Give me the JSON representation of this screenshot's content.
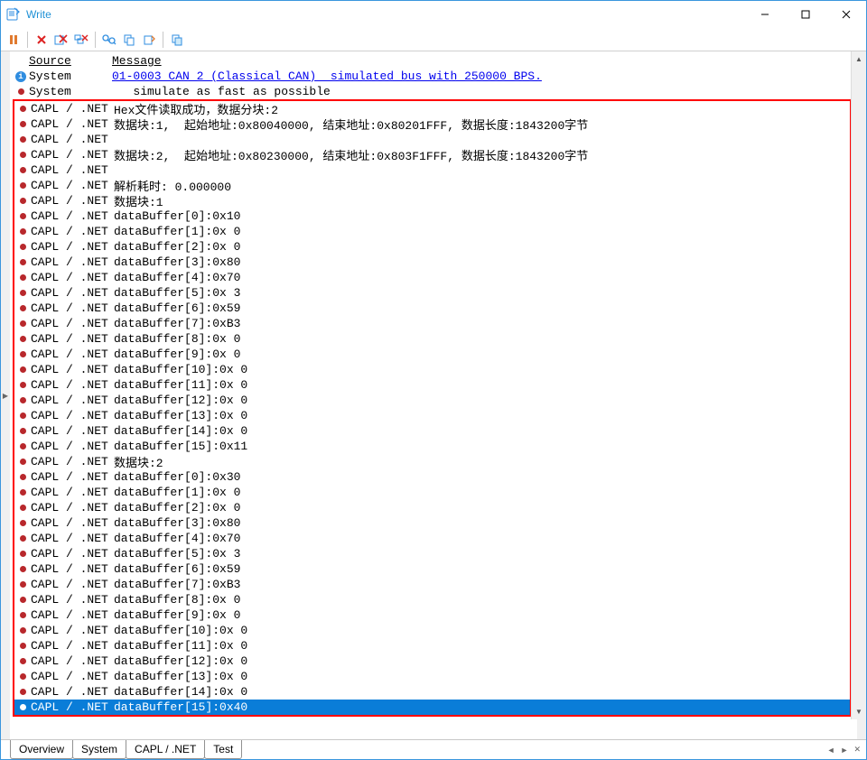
{
  "window": {
    "title": "Write"
  },
  "head": {
    "source": "Source",
    "message": "Message"
  },
  "top_rows": [
    {
      "icon": "info",
      "source": "System",
      "message": "01-0003 CAN 2 (Classical CAN)  simulated bus with 250000 BPS.",
      "link": true
    },
    {
      "icon": "bullet",
      "source": "System",
      "message": "   simulate as fast as possible"
    }
  ],
  "boxed_rows": [
    {
      "source": "CAPL / .NET",
      "message": "Hex文件读取成功，数据分块:2"
    },
    {
      "source": "CAPL / .NET",
      "message": "数据块:1,  起始地址:0x80040000, 结束地址:0x80201FFF, 数据长度:1843200字节"
    },
    {
      "source": "CAPL / .NET",
      "message": ""
    },
    {
      "source": "CAPL / .NET",
      "message": "数据块:2,  起始地址:0x80230000, 结束地址:0x803F1FFF, 数据长度:1843200字节"
    },
    {
      "source": "CAPL / .NET",
      "message": ""
    },
    {
      "source": "CAPL / .NET",
      "message": "解析耗时: 0.000000"
    },
    {
      "source": "CAPL / .NET",
      "message": "数据块:1"
    },
    {
      "source": "CAPL / .NET",
      "message": "dataBuffer[0]:0x10"
    },
    {
      "source": "CAPL / .NET",
      "message": "dataBuffer[1]:0x 0"
    },
    {
      "source": "CAPL / .NET",
      "message": "dataBuffer[2]:0x 0"
    },
    {
      "source": "CAPL / .NET",
      "message": "dataBuffer[3]:0x80"
    },
    {
      "source": "CAPL / .NET",
      "message": "dataBuffer[4]:0x70"
    },
    {
      "source": "CAPL / .NET",
      "message": "dataBuffer[5]:0x 3"
    },
    {
      "source": "CAPL / .NET",
      "message": "dataBuffer[6]:0x59"
    },
    {
      "source": "CAPL / .NET",
      "message": "dataBuffer[7]:0xB3"
    },
    {
      "source": "CAPL / .NET",
      "message": "dataBuffer[8]:0x 0"
    },
    {
      "source": "CAPL / .NET",
      "message": "dataBuffer[9]:0x 0"
    },
    {
      "source": "CAPL / .NET",
      "message": "dataBuffer[10]:0x 0"
    },
    {
      "source": "CAPL / .NET",
      "message": "dataBuffer[11]:0x 0"
    },
    {
      "source": "CAPL / .NET",
      "message": "dataBuffer[12]:0x 0"
    },
    {
      "source": "CAPL / .NET",
      "message": "dataBuffer[13]:0x 0"
    },
    {
      "source": "CAPL / .NET",
      "message": "dataBuffer[14]:0x 0"
    },
    {
      "source": "CAPL / .NET",
      "message": "dataBuffer[15]:0x11"
    },
    {
      "source": "CAPL / .NET",
      "message": "数据块:2"
    },
    {
      "source": "CAPL / .NET",
      "message": "dataBuffer[0]:0x30"
    },
    {
      "source": "CAPL / .NET",
      "message": "dataBuffer[1]:0x 0"
    },
    {
      "source": "CAPL / .NET",
      "message": "dataBuffer[2]:0x 0"
    },
    {
      "source": "CAPL / .NET",
      "message": "dataBuffer[3]:0x80"
    },
    {
      "source": "CAPL / .NET",
      "message": "dataBuffer[4]:0x70"
    },
    {
      "source": "CAPL / .NET",
      "message": "dataBuffer[5]:0x 3"
    },
    {
      "source": "CAPL / .NET",
      "message": "dataBuffer[6]:0x59"
    },
    {
      "source": "CAPL / .NET",
      "message": "dataBuffer[7]:0xB3"
    },
    {
      "source": "CAPL / .NET",
      "message": "dataBuffer[8]:0x 0"
    },
    {
      "source": "CAPL / .NET",
      "message": "dataBuffer[9]:0x 0"
    },
    {
      "source": "CAPL / .NET",
      "message": "dataBuffer[10]:0x 0"
    },
    {
      "source": "CAPL / .NET",
      "message": "dataBuffer[11]:0x 0"
    },
    {
      "source": "CAPL / .NET",
      "message": "dataBuffer[12]:0x 0"
    },
    {
      "source": "CAPL / .NET",
      "message": "dataBuffer[13]:0x 0"
    },
    {
      "source": "CAPL / .NET",
      "message": "dataBuffer[14]:0x 0"
    },
    {
      "source": "CAPL / .NET",
      "message": "dataBuffer[15]:0x40",
      "selected": true
    }
  ],
  "tabs": [
    "Overview",
    "System",
    "CAPL / .NET",
    "Test"
  ]
}
